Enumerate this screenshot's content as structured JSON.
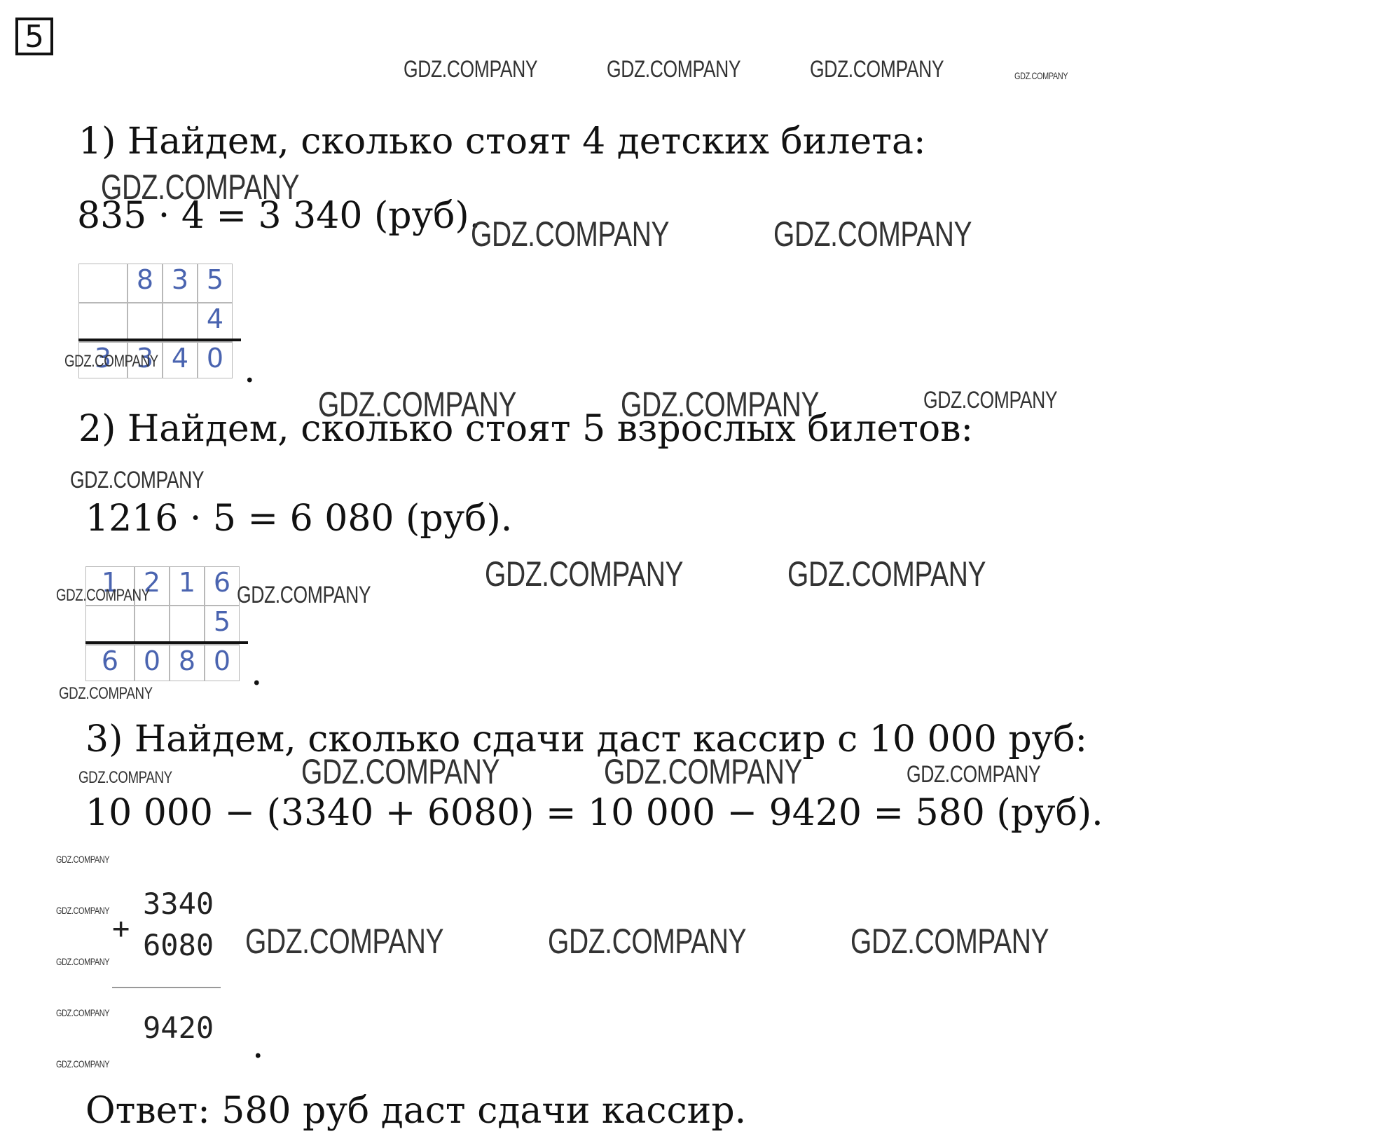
{
  "task_number": "5",
  "watermark": "GDZ.COMPANY",
  "step1": {
    "heading": "1) Найдем, сколько стоят 4 детских билета:",
    "equation": "835 · 4 = 3 340 (руб).",
    "grid": [
      [
        "",
        "8",
        "3",
        "5"
      ],
      [
        "",
        "",
        "",
        "4"
      ],
      [
        "3",
        "3",
        "4",
        "0"
      ]
    ]
  },
  "step2": {
    "heading": "2) Найдем, сколько стоят 5 взрослых билетов:",
    "equation": "1216 · 5 = 6 080 (руб).",
    "grid": [
      [
        "1",
        "2",
        "1",
        "6"
      ],
      [
        "",
        "",
        "",
        "5"
      ],
      [
        "6",
        "0",
        "8",
        "0"
      ]
    ]
  },
  "step3": {
    "heading": "3) Найдем, сколько сдачи даст кассир с 10 000 руб:",
    "equation": "10 000 − (3340 + 6080) = 10 000 − 9420 = 580 (руб).",
    "addend1": "3340",
    "addend2": "6080",
    "plus": "+",
    "sum": "9420"
  },
  "dot": ".",
  "answer": "Ответ: 580 руб даст сдачи кассир."
}
